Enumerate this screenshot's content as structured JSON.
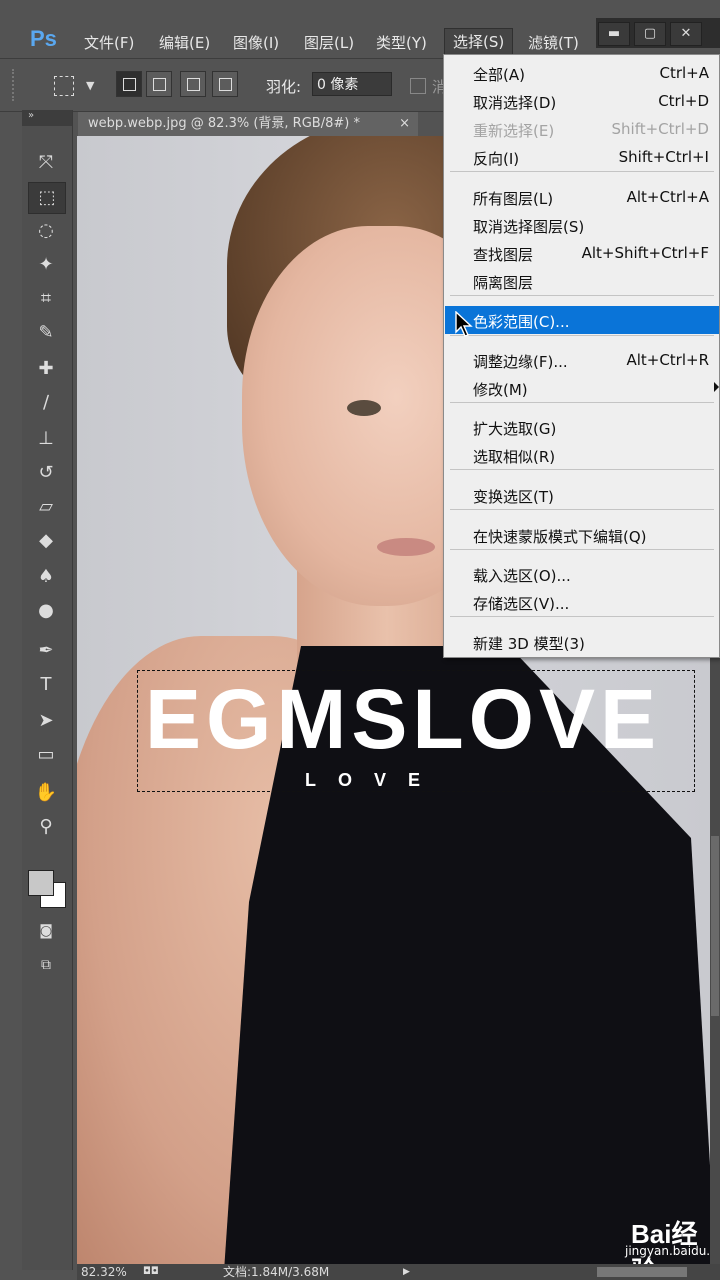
{
  "app": {
    "logo": "Ps"
  },
  "menubar": {
    "items": [
      "文件(F)",
      "编辑(E)",
      "图像(I)",
      "图层(L)",
      "类型(Y)",
      "选择(S)",
      "滤镜(T)"
    ],
    "active_index": 5
  },
  "window_controls": {
    "minimize": "▬",
    "maximize": "▢",
    "close": "✕"
  },
  "options_bar": {
    "feather_label": "羽化:",
    "feather_value": "0 像素",
    "truncated_label": "消"
  },
  "document": {
    "tab_title": "webp.webp.jpg @ 82.3% (背景, RGB/8#) *",
    "close": "×"
  },
  "canvas_text": {
    "logo_main": "EGMSLOVE",
    "logo_sub": "LOVE",
    "watermark": "Bai经验",
    "watermark_url": "jingyan.baidu.com"
  },
  "status_bar": {
    "zoom": "82.32%",
    "doc_info": "文档:1.84M/3.68M"
  },
  "select_menu": {
    "highlighted_index": 8,
    "items": [
      {
        "label": "全部(A)",
        "shortcut": "Ctrl+A",
        "disabled": false
      },
      {
        "label": "取消选择(D)",
        "shortcut": "Ctrl+D",
        "disabled": false
      },
      {
        "label": "重新选择(E)",
        "shortcut": "Shift+Ctrl+D",
        "disabled": true
      },
      {
        "label": "反向(I)",
        "shortcut": "Shift+Ctrl+I",
        "disabled": false
      },
      {
        "label": "所有图层(L)",
        "shortcut": "Alt+Ctrl+A",
        "disabled": false
      },
      {
        "label": "取消选择图层(S)",
        "shortcut": "",
        "disabled": false
      },
      {
        "label": "查找图层",
        "shortcut": "Alt+Shift+Ctrl+F",
        "disabled": false
      },
      {
        "label": "隔离图层",
        "shortcut": "",
        "disabled": false
      },
      {
        "label": "色彩范围(C)...",
        "shortcut": "",
        "disabled": false
      },
      {
        "label": "调整边缘(F)...",
        "shortcut": "Alt+Ctrl+R",
        "disabled": false
      },
      {
        "label": "修改(M)",
        "shortcut": "",
        "disabled": false,
        "submenu": true
      },
      {
        "label": "扩大选取(G)",
        "shortcut": "",
        "disabled": false
      },
      {
        "label": "选取相似(R)",
        "shortcut": "",
        "disabled": false
      },
      {
        "label": "变换选区(T)",
        "shortcut": "",
        "disabled": false
      },
      {
        "label": "在快速蒙版模式下编辑(Q)",
        "shortcut": "",
        "disabled": false
      },
      {
        "label": "载入选区(O)...",
        "shortcut": "",
        "disabled": false
      },
      {
        "label": "存储选区(V)...",
        "shortcut": "",
        "disabled": false
      },
      {
        "label": "新建 3D 模型(3)",
        "shortcut": "",
        "disabled": false
      }
    ]
  },
  "tools": [
    {
      "name": "move-tool-icon",
      "glyph": "⤧"
    },
    {
      "name": "rect-marquee-tool-icon",
      "glyph": "⬚"
    },
    {
      "name": "lasso-tool-icon",
      "glyph": "◌"
    },
    {
      "name": "magic-wand-tool-icon",
      "glyph": "✦"
    },
    {
      "name": "crop-tool-icon",
      "glyph": "⌗"
    },
    {
      "name": "eyedropper-tool-icon",
      "glyph": "✎"
    },
    {
      "name": "healing-brush-tool-icon",
      "glyph": "✚"
    },
    {
      "name": "brush-tool-icon",
      "glyph": "∕"
    },
    {
      "name": "clone-stamp-tool-icon",
      "glyph": "⊥"
    },
    {
      "name": "history-brush-tool-icon",
      "glyph": "↺"
    },
    {
      "name": "eraser-tool-icon",
      "glyph": "▱"
    },
    {
      "name": "paint-bucket-tool-icon",
      "glyph": "◆"
    },
    {
      "name": "blur-tool-icon",
      "glyph": "♠"
    },
    {
      "name": "dodge-tool-icon",
      "glyph": "●"
    },
    {
      "name": "pen-tool-icon",
      "glyph": "✒"
    },
    {
      "name": "type-tool-icon",
      "glyph": "T"
    },
    {
      "name": "path-selection-tool-icon",
      "glyph": "➤"
    },
    {
      "name": "shape-tool-icon",
      "glyph": "▭"
    },
    {
      "name": "hand-tool-icon",
      "glyph": "✋"
    },
    {
      "name": "zoom-tool-icon",
      "glyph": "⚲"
    }
  ],
  "colors": {
    "accent": "#0a74d8",
    "menu_bg": "#efefef",
    "chrome": "#535353"
  }
}
